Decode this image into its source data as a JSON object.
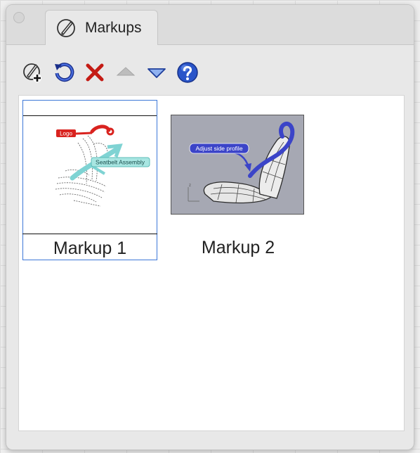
{
  "panel": {
    "tab": {
      "label": "Markups",
      "icon": "markup-pen-icon"
    }
  },
  "toolbar": {
    "tools": [
      {
        "name": "add-markup",
        "icon": "add-markup-icon"
      },
      {
        "name": "refresh",
        "icon": "refresh-icon"
      },
      {
        "name": "delete",
        "icon": "delete-x-icon"
      },
      {
        "name": "move-up",
        "icon": "triangle-up-icon"
      },
      {
        "name": "move-down",
        "icon": "triangle-down-icon"
      },
      {
        "name": "help",
        "icon": "help-icon"
      }
    ]
  },
  "markups": [
    {
      "caption": "Markup 1",
      "selected": true,
      "annotations": [
        "Logo",
        "Seatbelt Assembly"
      ]
    },
    {
      "caption": "Markup 2",
      "selected": false,
      "annotations": [
        "Adjust side profile"
      ]
    }
  ],
  "colors": {
    "selection": "#3d78d8",
    "markup_red": "#d9231f",
    "markup_cyan": "#7fd3d3",
    "markup_blue": "#3b44c8",
    "thumb2_bg": "#a6a8b3"
  }
}
